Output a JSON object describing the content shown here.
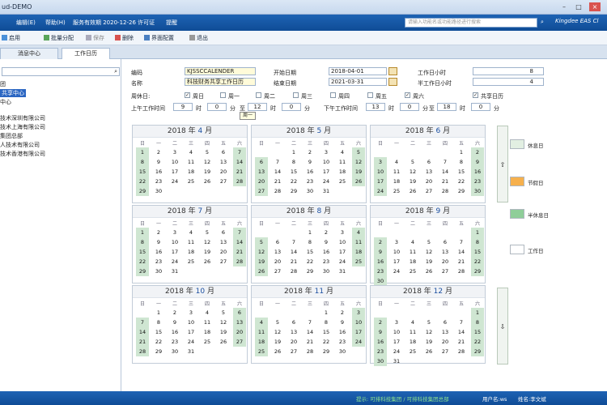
{
  "window": {
    "title": "ud-DEMO"
  },
  "menu": {
    "items": [
      "编辑(E)",
      "帮助(H)",
      "服务有效期 2020-12-26 许可证",
      "提醒"
    ],
    "search_placeholder": "请输入功能名或功能路径进行搜索",
    "logo": "Kingdee  EAS Cl"
  },
  "toolbar": {
    "buttons": [
      "启用",
      "批量分配",
      "保存",
      "删除",
      "界面配置",
      "退出"
    ]
  },
  "tabs": [
    {
      "label": "消息中心"
    },
    {
      "label": "工作日历"
    }
  ],
  "tree": {
    "items": [
      {
        "label": "团",
        "selected": false
      },
      {
        "label": "共享中心",
        "selected": true
      },
      {
        "label": "中心",
        "selected": false
      },
      {
        "label": "技术深圳有限公司",
        "selected": false
      },
      {
        "label": "技术上海有限公司",
        "selected": false
      },
      {
        "label": "集团总部",
        "selected": false
      },
      {
        "label": "人技术有限公司",
        "selected": false
      },
      {
        "label": "技术香港有限公司",
        "selected": false
      }
    ]
  },
  "form": {
    "code_label": "编码",
    "code_value": "KJSSCCALENDER",
    "name_label": "名称",
    "name_value": "科技财务共享工作日历",
    "start_label": "开始日期",
    "start_value": "2018-04-01",
    "end_label": "结束日期",
    "end_value": "2021-03-31",
    "workday_hours_label": "工作日小时",
    "workday_hours_value": "8",
    "halfday_hours_label": "半工作日小时",
    "halfday_hours_value": "4",
    "weekday_label": "周休日:",
    "weekdays": [
      {
        "label": "周日",
        "checked": true
      },
      {
        "label": "周一",
        "checked": false
      },
      {
        "label": "周二",
        "checked": false
      },
      {
        "label": "周三",
        "checked": false
      },
      {
        "label": "周四",
        "checked": false
      },
      {
        "label": "周五",
        "checked": false
      },
      {
        "label": "周六",
        "checked": true
      }
    ],
    "shared_label": "共享日历",
    "shared_checked": true,
    "am_label": "上午工作时间",
    "am_from_h": "9",
    "am_from_m": "0",
    "am_to_h": "12",
    "am_to_m": "0",
    "pm_label": "下午工作时间",
    "pm_from_h": "13",
    "pm_from_m": "0",
    "pm_to_h": "18",
    "pm_to_m": "0",
    "hour_unit": "时",
    "min_unit": "分",
    "sep": "至",
    "tooltip": "周一"
  },
  "calendar": {
    "year": "2018",
    "year_suffix": "年",
    "month_suffix": "月",
    "dow": [
      "日",
      "一",
      "二",
      "三",
      "四",
      "五",
      "六"
    ],
    "months": [
      {
        "month": "4",
        "start": 0,
        "days": 30
      },
      {
        "month": "5",
        "start": 2,
        "days": 31
      },
      {
        "month": "6",
        "start": 5,
        "days": 30
      },
      {
        "month": "7",
        "start": 0,
        "days": 31
      },
      {
        "month": "8",
        "start": 3,
        "days": 31
      },
      {
        "month": "9",
        "start": 6,
        "days": 30
      },
      {
        "month": "10",
        "start": 1,
        "days": 31
      },
      {
        "month": "11",
        "start": 4,
        "days": 30
      },
      {
        "month": "12",
        "start": 6,
        "days": 31
      }
    ]
  },
  "legend": [
    {
      "label": "休息日",
      "color": "#e2efe2"
    },
    {
      "label": "节假日",
      "color": "#f6b04d"
    },
    {
      "label": "半休息日",
      "color": "#8fce99"
    },
    {
      "label": "工作日",
      "color": "#ffffff"
    }
  ],
  "nav": {
    "up": "⇧",
    "down": "⇩"
  },
  "status": {
    "left": "提示: 可排科技集团 / 可排科技集团总部",
    "user": "用户名:ws",
    "mode": "姓名:李文斌"
  }
}
